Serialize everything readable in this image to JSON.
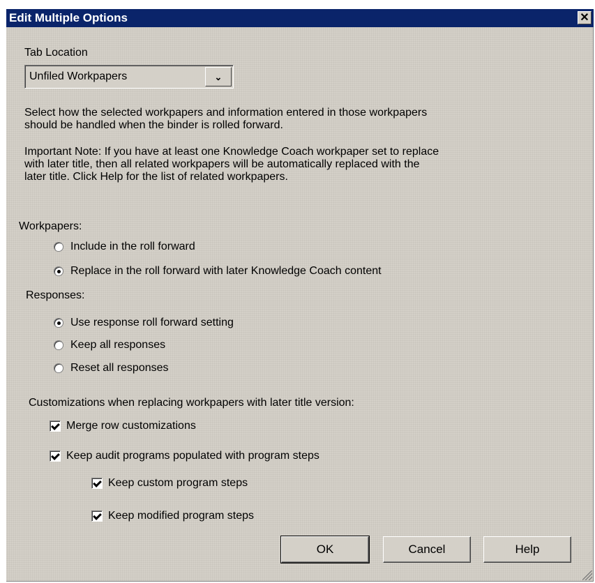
{
  "window": {
    "title": "Edit Multiple Options",
    "close_glyph": "✕"
  },
  "tab_location": {
    "label": "Tab Location",
    "value": "Unfiled Workpapers",
    "arrow": "⌄"
  },
  "description": [
    "Select how the selected workpapers and information entered in those workpapers",
    "should be handled when the binder is rolled forward."
  ],
  "note": [
    "Important Note: If you have at least one Knowledge Coach workpaper set to replace",
    "with later title, then all related workpapers will be automatically replaced with the",
    "later title. Click Help for the list of related workpapers."
  ],
  "workpapers": {
    "label": "Workpapers:",
    "options": [
      {
        "label": "Include in the roll forward",
        "selected": false
      },
      {
        "label": "Replace in the roll forward with later Knowledge Coach content",
        "selected": true
      }
    ]
  },
  "responses": {
    "label": "Responses:",
    "options": [
      {
        "label": "Use response roll forward setting",
        "selected": true
      },
      {
        "label": "Keep all responses",
        "selected": false
      },
      {
        "label": "Reset all responses",
        "selected": false
      }
    ]
  },
  "customizations": {
    "label": "Customizations when replacing workpapers with later title version:",
    "merge_row": {
      "label": "Merge row customizations",
      "checked": true
    },
    "keep_audit": {
      "label": "Keep audit programs populated with program steps",
      "checked": true
    },
    "keep_custom": {
      "label": "Keep custom program steps",
      "checked": true
    },
    "keep_modified": {
      "label": "Keep modified program steps",
      "checked": true
    }
  },
  "buttons": {
    "ok": "OK",
    "cancel": "Cancel",
    "help": "Help"
  }
}
